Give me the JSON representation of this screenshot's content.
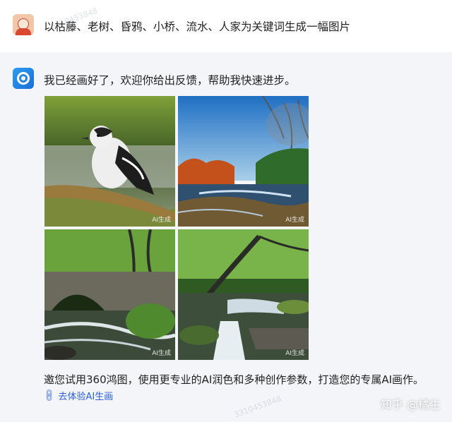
{
  "user_message": {
    "text": "以枯藤、老树、昏鸦、小桥、流水、人家为关键词生成一幅图片"
  },
  "bot_message": {
    "reply": "我已经画好了，欢迎你给出反馈，帮助我快速进步。",
    "images": [
      {
        "label": "AI生成",
        "subject": "bird on mossy branch"
      },
      {
        "label": "AI生成",
        "subject": "river under blue sky"
      },
      {
        "label": "AI生成",
        "subject": "stone bridge over stream"
      },
      {
        "label": "AI生成",
        "subject": "waterfall in forest"
      }
    ],
    "promo": "邀您试用360鸿图，使用更专业的AI润色和多种创作参数，打造您的专属AI画作。",
    "link_label": "去体验AI生画",
    "link_icon": "link-icon"
  },
  "watermark": {
    "text": "知乎 @橘生",
    "faint": "3310453848"
  }
}
